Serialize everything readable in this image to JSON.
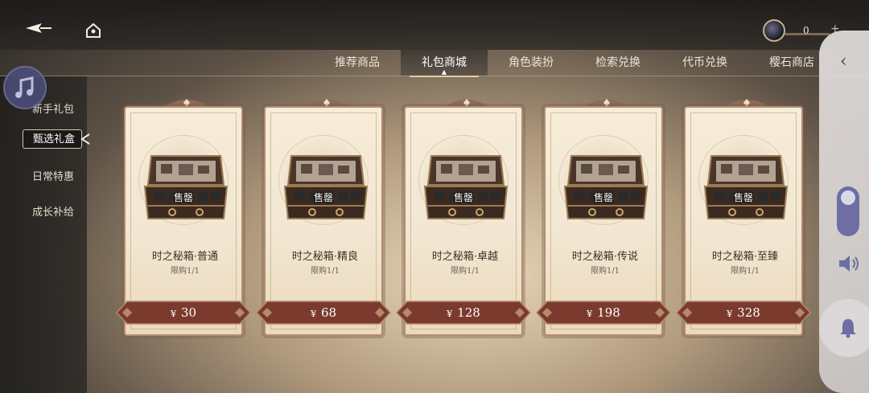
{
  "topbar": {
    "currency_value": "0",
    "currency_plus": "+"
  },
  "tabs": [
    {
      "label": "推荐商品",
      "active": false
    },
    {
      "label": "礼包商城",
      "active": true
    },
    {
      "label": "角色装扮",
      "active": false
    },
    {
      "label": "检索兑换",
      "active": false
    },
    {
      "label": "代币兑换",
      "active": false
    },
    {
      "label": "樱石商店",
      "active": false
    }
  ],
  "sidebar": {
    "items": [
      {
        "label": "新手礼包",
        "active": false
      },
      {
        "label": "甄选礼盒",
        "active": true
      },
      {
        "label": "日常特惠",
        "active": false
      },
      {
        "label": "成长补给",
        "active": false
      }
    ]
  },
  "cards": [
    {
      "name": "时之秘箱·普通",
      "status": "售罄",
      "limit": "限购1/1",
      "currency": "¥",
      "price": "30"
    },
    {
      "name": "时之秘箱·精良",
      "status": "售罄",
      "limit": "限购1/1",
      "currency": "¥",
      "price": "68"
    },
    {
      "name": "时之秘箱·卓越",
      "status": "售罄",
      "limit": "限购1/1",
      "currency": "¥",
      "price": "128"
    },
    {
      "name": "时之秘箱·传说",
      "status": "售罄",
      "limit": "限购1/1",
      "currency": "¥",
      "price": "198"
    },
    {
      "name": "时之秘箱·至臻",
      "status": "售罄",
      "limit": "限购1/1",
      "currency": "¥",
      "price": "328"
    }
  ],
  "colors": {
    "price_button": "#7a3b2e",
    "card_bg": "#f4ead5",
    "card_border": "#b08c73",
    "toggle": "#6d6ea3"
  },
  "icons": [
    "back-arrow-icon",
    "home-icon",
    "currency-orb-icon",
    "music-note-icon",
    "chevron-left-icon",
    "speaker-icon",
    "bell-icon",
    "chest-icon"
  ]
}
